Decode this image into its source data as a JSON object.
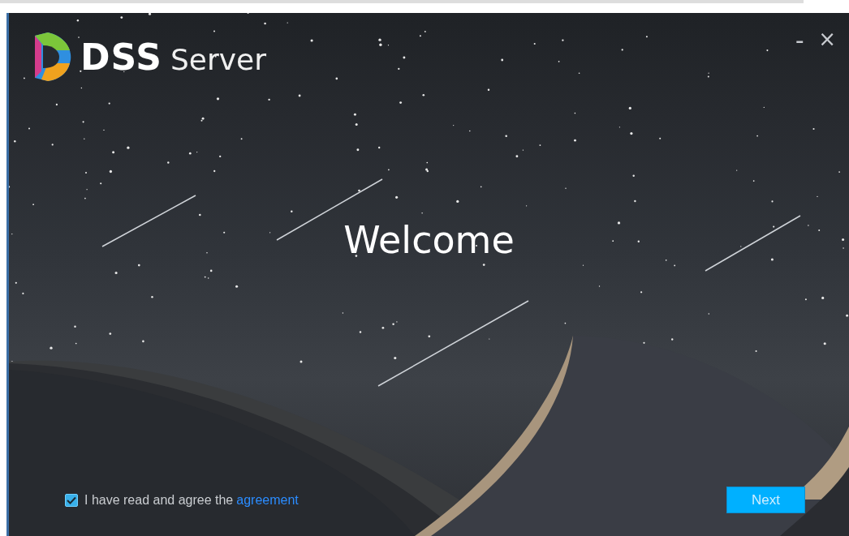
{
  "window": {
    "logo": {
      "brand": "DSS",
      "product": "Server"
    },
    "controls": [
      {
        "kind": "minimize",
        "label": "–"
      },
      {
        "kind": "close",
        "label": "×"
      }
    ]
  },
  "heading": "Welcome",
  "agreement": {
    "checked": true,
    "text": "I have read and agree the",
    "link": "agreement"
  },
  "next_button": {
    "label": "Next"
  }
}
